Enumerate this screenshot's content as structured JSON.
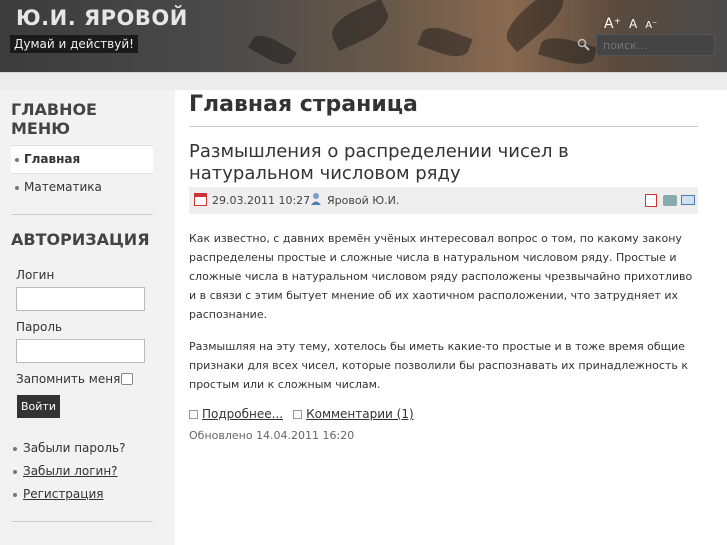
{
  "header": {
    "site_title": "Ю.И. ЯРОВОЙ",
    "slogan": "Думай и действуй!",
    "font_big": "A⁺",
    "font_mid": "A",
    "font_small": "A⁻",
    "search_placeholder": "поиск..."
  },
  "sidebar": {
    "menu_title": "ГЛАВНОЕ МЕНЮ",
    "menu_items": [
      {
        "label": "Главная",
        "active": true
      },
      {
        "label": "Математика",
        "active": false
      }
    ],
    "auth_title": "АВТОРИЗАЦИЯ",
    "login_label": "Логин",
    "password_label": "Пароль",
    "remember_label": "Запомнить меня",
    "login_button": "Войти",
    "links": [
      {
        "label": "Забыли пароль?"
      },
      {
        "label": "Забыли логин?"
      },
      {
        "label": "Регистрация"
      }
    ]
  },
  "main": {
    "page_title": "Главная страница",
    "article_title": "Размышления о распределении чисел в натуральном числовом ряду",
    "date": "29.03.2011 10:27",
    "author": "Яровой Ю.И.",
    "paragraph1": "Как известно, с давних времён учёных интересовал вопрос о том, по какому закону распределены простые и сложные числа в натуральном числовом ряду. Простые и сложные числа в натуральном числовом ряду расположены чрезвычайно прихотливо и в связи с этим бытует мнение об их хаотичном расположении, что затрудняет их распознание.",
    "paragraph2": "Размышляя на эту тему, хотелось бы иметь какие-то простые и в тоже время общие признаки для всех чисел, которые позволили бы распознавать их принадлежность к простым или к сложным числам.",
    "read_more": "Подробнее...",
    "comments": "Комментарии (1)",
    "updated": "Обновлено 14.04.2011 16:20"
  }
}
